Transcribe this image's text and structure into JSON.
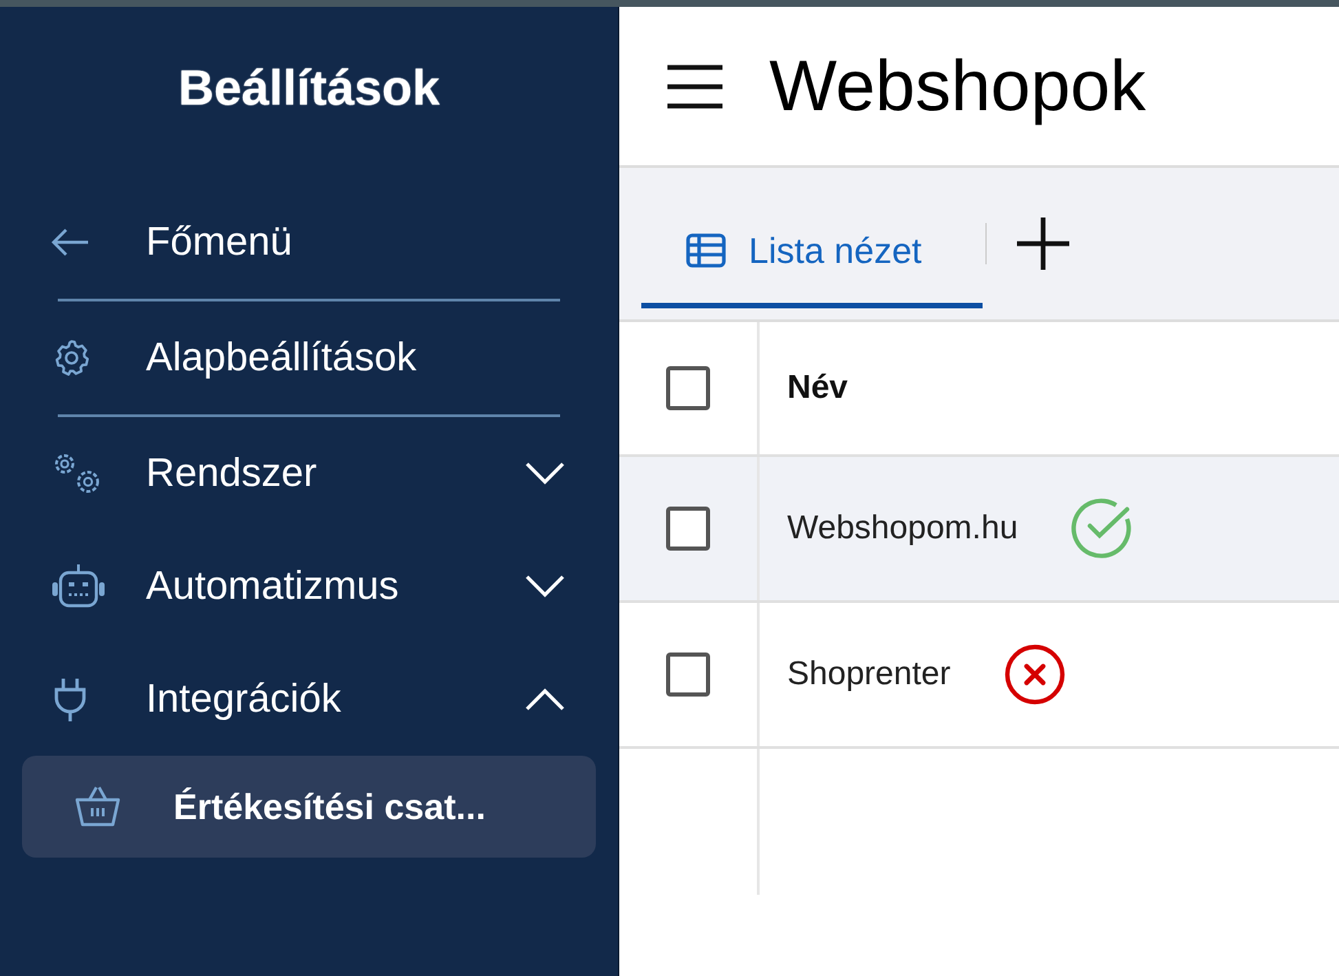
{
  "sidebar": {
    "title": "Beállítások",
    "items": [
      {
        "label": "Főmenü",
        "kind": "link"
      },
      {
        "label": "Alapbeállítások",
        "kind": "link"
      },
      {
        "label": "Rendszer",
        "kind": "group",
        "expanded": false
      },
      {
        "label": "Automatizmus",
        "kind": "group",
        "expanded": false
      },
      {
        "label": "Integrációk",
        "kind": "group",
        "expanded": true,
        "children": [
          {
            "label": "Értékesítési csat...",
            "selected": true
          }
        ]
      }
    ]
  },
  "header": {
    "title": "Webshopok"
  },
  "tabs": [
    {
      "label": "Lista nézet",
      "selected": true
    }
  ],
  "table": {
    "columns": [
      "Név"
    ],
    "header_checked": false,
    "rows": [
      {
        "name": "Webshopom.hu",
        "kind": "ok",
        "checked": false,
        "highlighted": true
      },
      {
        "name": "Shoprenter",
        "kind": "error",
        "checked": false,
        "highlighted": false
      }
    ]
  }
}
